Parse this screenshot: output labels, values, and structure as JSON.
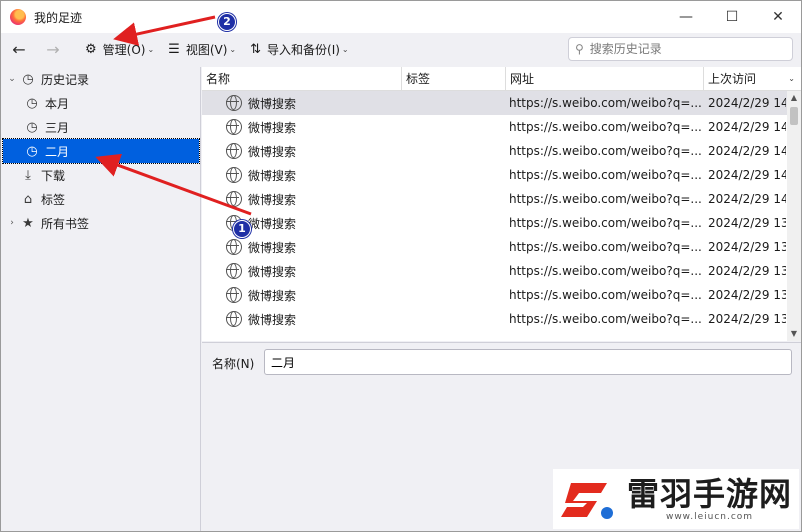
{
  "window": {
    "title": "我的足迹",
    "controls": {
      "minimize": "—",
      "maximize": "☐",
      "close": "✕"
    }
  },
  "toolbar": {
    "back_icon": "←",
    "forward_icon": "→",
    "manage_label": "管理(O)",
    "view_label": "视图(V)",
    "import_label": "导入和备份(I)",
    "search_placeholder": "搜索历史记录"
  },
  "sidebar": {
    "items": [
      {
        "label": "历史记录",
        "icon": "clock-icon",
        "twisty": "⌄"
      },
      {
        "label": "本月",
        "icon": "clock-icon"
      },
      {
        "label": "三月",
        "icon": "clock-icon"
      },
      {
        "label": "二月",
        "icon": "clock-icon",
        "selected": true
      },
      {
        "label": "下载",
        "icon": "download-icon"
      },
      {
        "label": "标签",
        "icon": "tag-icon"
      },
      {
        "label": "所有书签",
        "icon": "star-icon",
        "twisty": "›"
      }
    ]
  },
  "table": {
    "columns": {
      "name": "名称",
      "tags": "标签",
      "url": "网址",
      "last_visit": "上次访问"
    },
    "rows": [
      {
        "name": "微博搜索",
        "url": "https://s.weibo.com/weibo?q=...",
        "date": "2024/2/29 14"
      },
      {
        "name": "微博搜索",
        "url": "https://s.weibo.com/weibo?q=...",
        "date": "2024/2/29 14"
      },
      {
        "name": "微博搜索",
        "url": "https://s.weibo.com/weibo?q=...",
        "date": "2024/2/29 14"
      },
      {
        "name": "微博搜索",
        "url": "https://s.weibo.com/weibo?q=...",
        "date": "2024/2/29 14"
      },
      {
        "name": "微博搜索",
        "url": "https://s.weibo.com/weibo?q=...",
        "date": "2024/2/29 14"
      },
      {
        "name": "微博搜索",
        "url": "https://s.weibo.com/weibo?q=...",
        "date": "2024/2/29 13"
      },
      {
        "name": "微博搜索",
        "url": "https://s.weibo.com/weibo?q=...",
        "date": "2024/2/29 13"
      },
      {
        "name": "微博搜索",
        "url": "https://s.weibo.com/weibo?q=...",
        "date": "2024/2/29 13"
      },
      {
        "name": "微博搜索",
        "url": "https://s.weibo.com/weibo?q=...",
        "date": "2024/2/29 13"
      },
      {
        "name": "微博搜索",
        "url": "https://s.weibo.com/weibo?q=...",
        "date": "2024/2/29 13"
      }
    ]
  },
  "detail": {
    "name_label": "名称(N)",
    "name_value": "二月"
  },
  "annotations": {
    "badge1": "1",
    "badge2": "2",
    "arrow_color": "#e02020"
  },
  "watermark": {
    "name": "雷羽手游网",
    "url": "www.leiucn.com"
  },
  "colors": {
    "selection": "#0060df",
    "row_highlight": "#e0e0e6"
  }
}
